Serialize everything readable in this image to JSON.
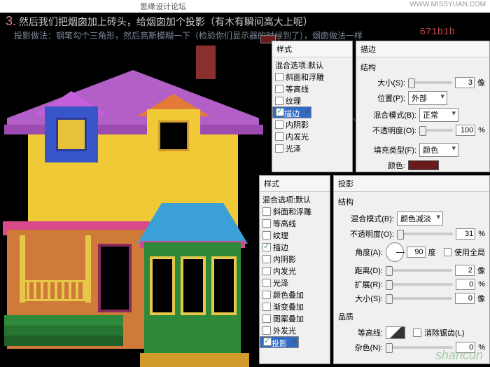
{
  "header": {
    "top_text": "思缘设计论坛",
    "url": "WWW.MISSYUAN.COM"
  },
  "instruction": {
    "step": "3.",
    "text": "然后我们把烟囱加上砖头，给烟囱加个投影（有木有瞬间高大上呢）",
    "sub": "投影做法：钢笔勾个三角形，然后高斯模糊一下（检验你们显示器的时候到了），烟囱做法一样"
  },
  "hex": "671b1b",
  "panelA": {
    "title": "样式",
    "default": "混合选项:默认",
    "items": [
      {
        "label": "斜面和浮雕",
        "checked": false
      },
      {
        "label": "等高线",
        "checked": false
      },
      {
        "label": "纹理",
        "checked": false
      },
      {
        "label": "描边",
        "checked": true,
        "selected": true
      },
      {
        "label": "内阴影",
        "checked": false
      },
      {
        "label": "内发光",
        "checked": false
      },
      {
        "label": "光泽",
        "checked": false
      }
    ]
  },
  "panelB": {
    "title": "描边",
    "group": "结构",
    "size_label": "大小(S):",
    "size_val": "3",
    "size_unit": "像",
    "pos_label": "位置(P):",
    "pos_val": "外部",
    "blend_label": "混合模式(B):",
    "blend_val": "正常",
    "opacity_label": "不透明度(O):",
    "opacity_val": "100",
    "pct": "%",
    "filltype_label": "填充类型(F):",
    "filltype_val": "颜色",
    "color_label": "颜色:"
  },
  "panelC": {
    "title": "样式",
    "default": "混合选项:默认",
    "items": [
      {
        "label": "斜面和浮雕",
        "checked": false
      },
      {
        "label": "等高线",
        "checked": false
      },
      {
        "label": "纹理",
        "checked": false
      },
      {
        "label": "描边",
        "checked": true
      },
      {
        "label": "内阴影",
        "checked": false
      },
      {
        "label": "内发光",
        "checked": false
      },
      {
        "label": "光泽",
        "checked": false
      },
      {
        "label": "颜色叠加",
        "checked": false
      },
      {
        "label": "渐变叠加",
        "checked": false
      },
      {
        "label": "图案叠加",
        "checked": false
      },
      {
        "label": "外发光",
        "checked": false
      },
      {
        "label": "投影",
        "checked": true,
        "selected": true
      }
    ]
  },
  "panelD": {
    "title": "投影",
    "group1": "结构",
    "blend_label": "混合模式(B):",
    "blend_val": "颜色减淡",
    "opacity_label": "不透明度(O):",
    "opacity_val": "31",
    "pct": "%",
    "angle_label": "角度(A):",
    "angle_val": "90",
    "deg": "度",
    "global": "使用全局",
    "dist_label": "距离(D):",
    "dist_val": "2",
    "dist_unit": "像",
    "spread_label": "扩展(R):",
    "spread_val": "0",
    "pct2": "%",
    "size_label": "大小(S):",
    "size_val": "0",
    "size_unit": "像",
    "group2": "品质",
    "contour_label": "等高线:",
    "anti": "消除锯齿(L)",
    "noise_label": "杂色(N):",
    "noise_val": "0",
    "pct3": "%"
  },
  "watermark": "shancun"
}
